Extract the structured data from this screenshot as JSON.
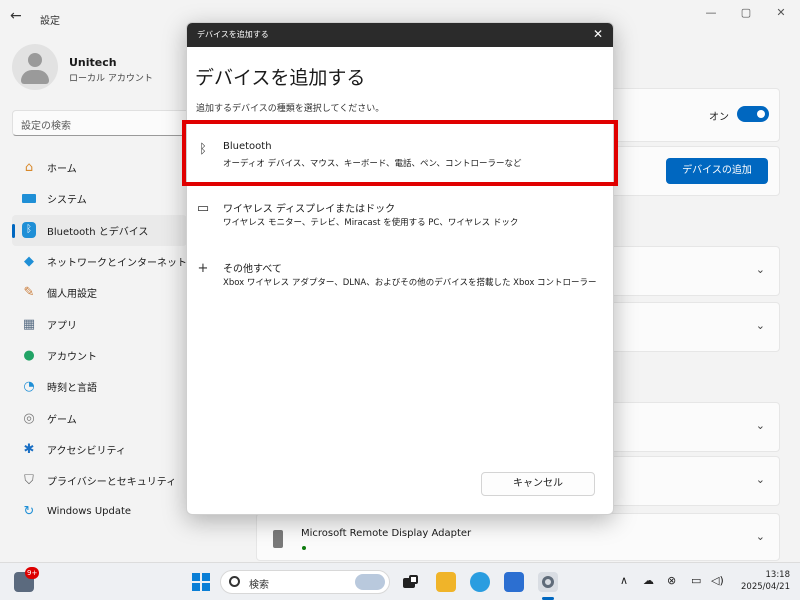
{
  "app": {
    "title": "設定"
  },
  "window_controls": {
    "minimize": "—",
    "maximize": "▢",
    "close": "✕"
  },
  "profile": {
    "name": "Unitech",
    "account": "ローカル アカウント"
  },
  "search": {
    "placeholder": "設定の検索"
  },
  "nav": {
    "items": [
      {
        "label": "ホーム",
        "icon": "home-icon",
        "glyph": "⌂",
        "color": "#d8892b"
      },
      {
        "label": "システム",
        "icon": "system-icon",
        "glyph": "▬",
        "color": "#1f8fd6"
      },
      {
        "label": "Bluetooth とデバイス",
        "icon": "bluetooth-icon",
        "glyph": "ᛒ",
        "color": "#ffffff",
        "active": true
      },
      {
        "label": "ネットワークとインターネット",
        "icon": "wifi-icon",
        "glyph": "◆",
        "color": "#1f8fd6"
      },
      {
        "label": "個人用設定",
        "icon": "brush-icon",
        "glyph": "✎",
        "color": "#c97a36"
      },
      {
        "label": "アプリ",
        "icon": "apps-icon",
        "glyph": "▦",
        "color": "#5a6f86"
      },
      {
        "label": "アカウント",
        "icon": "account-icon",
        "glyph": "●",
        "color": "#21a365"
      },
      {
        "label": "時刻と言語",
        "icon": "clock-globe-icon",
        "glyph": "◔",
        "color": "#1f8fd6"
      },
      {
        "label": "ゲーム",
        "icon": "gamepad-icon",
        "glyph": "◎",
        "color": "#7a7a7a"
      },
      {
        "label": "アクセシビリティ",
        "icon": "accessibility-icon",
        "glyph": "✱",
        "color": "#1a6fc4"
      },
      {
        "label": "プライバシーとセキュリティ",
        "icon": "shield-icon",
        "glyph": "⛉",
        "color": "#6a6a6a"
      },
      {
        "label": "Windows Update",
        "icon": "update-icon",
        "glyph": "↻",
        "color": "#1f8fd6"
      }
    ]
  },
  "content": {
    "toggle_label": "オン",
    "add_device_label": "デバイスの追加",
    "chevron": "⌄",
    "remote_device_name": "Microsoft Remote Display Adapter"
  },
  "dialog": {
    "window_title": "デバイスを追加する",
    "close_glyph": "✕",
    "heading": "デバイスを追加する",
    "subtitle": "追加するデバイスの種類を選択してください。",
    "options": [
      {
        "title": "Bluetooth",
        "desc": "オーディオ デバイス、マウス、キーボード、電話、ペン、コントローラーなど",
        "icon": "bluetooth-icon",
        "glyph": "ᛒ"
      },
      {
        "title": "ワイヤレス ディスプレイまたはドック",
        "desc": "ワイヤレス モニター、テレビ、Miracast を使用する PC、ワイヤレス ドック",
        "icon": "monitor-icon",
        "glyph": "▭"
      },
      {
        "title": "その他すべて",
        "desc": "Xbox ワイヤレス アダプター、DLNA、およびその他のデバイスを搭載した Xbox コントローラー",
        "icon": "plus-icon",
        "glyph": "+"
      }
    ],
    "cancel_label": "キャンセル"
  },
  "taskbar": {
    "badge": "9+",
    "search_placeholder": "検索",
    "time": "13:18",
    "date": "2025/04/21"
  },
  "colors": {
    "accent": "#0067c0",
    "highlight": "#e00000"
  }
}
